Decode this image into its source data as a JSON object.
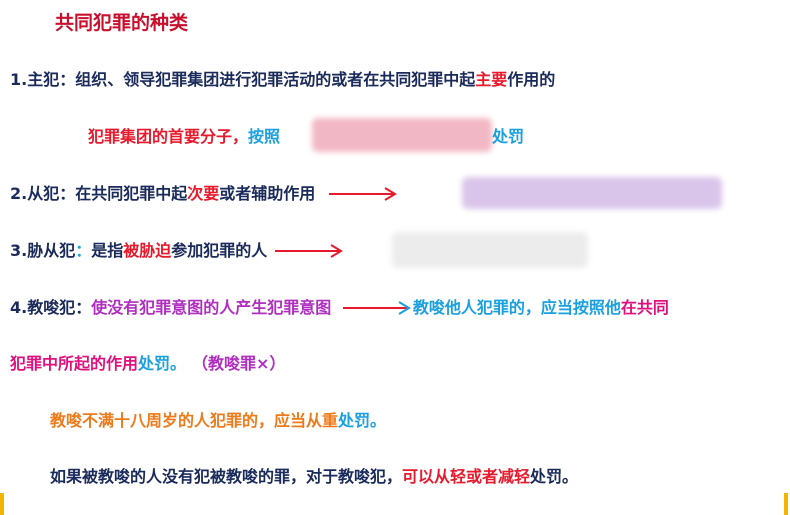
{
  "title": "共同犯罪的种类",
  "item1": {
    "prefix": "1.主犯：组织、领导犯罪集团进行犯罪活动的或者在共同犯罪中起",
    "highlight": "主要",
    "suffix": "作用的",
    "sub_red": "犯罪集团的首要分子，",
    "sub_blue_start": "按照",
    "sub_blue_end": "处罚"
  },
  "item2": {
    "prefix": "2.从犯：在共同犯罪中起",
    "highlight": "次要",
    "suffix": "或者辅助作用"
  },
  "item3": {
    "prefix": "3.胁从犯",
    "colon": "：",
    "middle": "是指",
    "highlight": "被胁迫",
    "suffix": "参加犯罪的人"
  },
  "item4": {
    "prefix": "4.教唆犯：",
    "purple": "使没有犯罪意图的人产生犯罪意图",
    "blue": "教唆他人犯罪的，应当按照他",
    "pink": "在共同"
  },
  "item4_cont": {
    "pink": "犯罪中所起的作用",
    "blue": "处罚。",
    "purple": "（教唆罪×）"
  },
  "note1": {
    "orange": "教唆不满十八周岁的人犯罪的，应当从重",
    "blue": "处罚。"
  },
  "note2": {
    "navy": "如果被教唆的人没有犯被教唆的罪，对于教唆犯，",
    "red": "可以从轻或者减轻",
    "tail": "处罚。"
  },
  "colors": {
    "title": "#c8102e",
    "red": "#e8192c",
    "blue": "#1aa0e0",
    "pink": "#e0117f",
    "purple": "#b02ec0",
    "orange": "#ee7a1a",
    "navy": "#1a2a5a",
    "arrow_red": "#e8192c",
    "arrow_blue": "#1aa0e0"
  },
  "icons": [
    "arrow-right-icon"
  ]
}
